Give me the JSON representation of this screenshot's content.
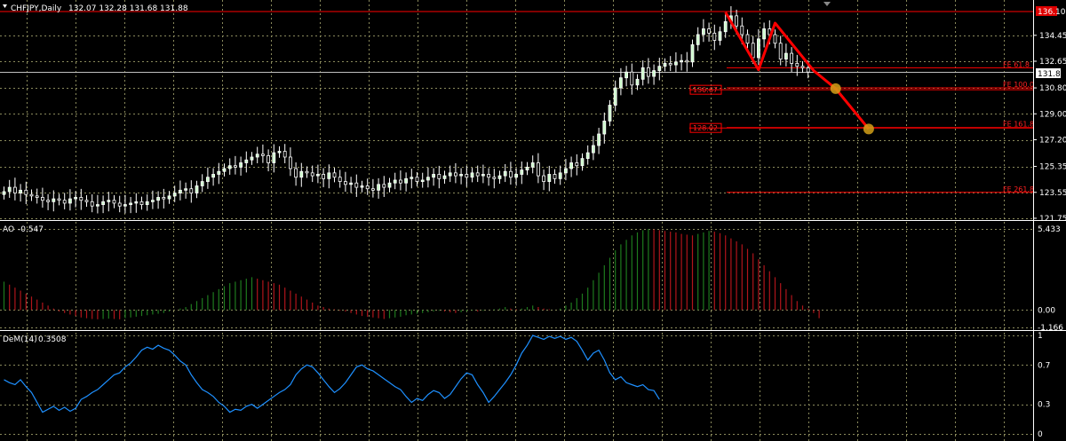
{
  "header": {
    "symbol": "CHFJPY,Daily",
    "ohlc": "132.07 132.28 131.68 131.88"
  },
  "colors": {
    "background": "#000000",
    "grid": "#8a8a5c",
    "bull_candle": "#ccffcc",
    "bear_candle": "#000000",
    "candle_wick": "#ffffff",
    "ao_up": "#1e7a1e",
    "ao_down": "#b0151b",
    "dem_line": "#1e90ff",
    "annotation": "#ff0000",
    "marker": "#d4a017"
  },
  "chart_data": [
    {
      "type": "candlestick",
      "title": "CHFJPY,Daily",
      "ylim": [
        121.75,
        136.1
      ],
      "y_ticks": [
        "134.45",
        "132.65",
        "130.80",
        "129.00",
        "127.20",
        "125.35",
        "123.55",
        "121.75"
      ],
      "current_price": "131.88",
      "top_price": "136.10",
      "grid": true,
      "close": [
        123.6,
        123.9,
        123.5,
        123.7,
        123.4,
        123.3,
        123.2,
        123.0,
        122.9,
        123.1,
        123.0,
        122.8,
        123.1,
        123.2,
        123.0,
        122.9,
        122.6,
        122.7,
        122.9,
        123.0,
        122.8,
        122.6,
        122.7,
        122.8,
        122.9,
        122.7,
        122.9,
        123.0,
        123.2,
        123.1,
        123.3,
        123.5,
        123.7,
        123.8,
        123.5,
        124.0,
        124.3,
        124.6,
        124.8,
        125.0,
        125.2,
        125.4,
        125.3,
        125.6,
        125.8,
        126.0,
        126.2,
        126.1,
        125.6,
        126.3,
        126.4,
        126.0,
        125.2,
        124.6,
        125.0,
        124.9,
        124.7,
        124.8,
        124.5,
        124.9,
        124.6,
        124.3,
        124.1,
        124.2,
        123.9,
        124.0,
        123.8,
        123.7,
        124.1,
        123.9,
        124.2,
        124.4,
        124.2,
        124.5,
        124.6,
        124.3,
        124.4,
        124.6,
        124.8,
        124.5,
        124.7,
        124.9,
        124.7,
        124.8,
        124.6,
        124.9,
        124.7,
        124.8,
        124.6,
        124.5,
        124.7,
        125.0,
        124.6,
        124.8,
        125.1,
        125.3,
        125.6,
        124.7,
        124.3,
        124.8,
        124.5,
        124.9,
        125.2,
        125.6,
        125.4,
        125.9,
        126.3,
        126.8,
        127.6,
        128.5,
        129.6,
        130.8,
        131.5,
        131.9,
        131.0,
        131.4,
        132.2,
        131.6,
        132.0,
        132.3,
        132.5,
        132.4,
        132.6,
        132.7,
        132.6,
        133.8,
        134.5,
        134.9,
        134.6,
        134.1,
        134.7,
        135.4,
        135.8,
        135.1,
        134.5,
        133.9,
        132.9,
        134.2,
        134.9,
        134.5,
        133.9,
        132.8,
        133.2,
        132.5,
        132.3,
        132.2,
        131.9
      ],
      "annotations": {
        "fe_levels": [
          {
            "label": "FE 61.8",
            "price": 132.2
          },
          {
            "label": "FE 100.0",
            "price": 130.8
          },
          {
            "label": "FE 161.8",
            "price": 128.05
          },
          {
            "label": "FE 261.8",
            "price": 123.55
          }
        ],
        "price_tags": [
          {
            "label": "130.67",
            "price": 130.67
          },
          {
            "label": "128.02",
            "price": 128.02
          }
        ],
        "zigzag": [
          {
            "bar": 131,
            "price": 136.05
          },
          {
            "bar": 137,
            "price": 132.05
          },
          {
            "bar": 140,
            "price": 135.3
          },
          {
            "bar": 147,
            "price": 132.0
          },
          {
            "bar": 151,
            "price": 130.75
          },
          {
            "bar": 157,
            "price": 127.95
          }
        ],
        "markers": [
          {
            "bar": 151,
            "price": 130.75
          },
          {
            "bar": 157,
            "price": 127.95
          }
        ]
      }
    },
    {
      "type": "bar",
      "title": "AO",
      "current_value": "-0.547",
      "y_ticks": [
        "5.433",
        "0.00",
        "-1.166"
      ],
      "ylim": [
        -1.166,
        5.433
      ],
      "values": [
        1.9,
        1.7,
        1.5,
        1.3,
        1.1,
        0.9,
        0.7,
        0.5,
        0.3,
        0.1,
        -0.1,
        -0.2,
        -0.3,
        -0.4,
        -0.5,
        -0.55,
        -0.6,
        -0.62,
        -0.6,
        -0.58,
        -0.6,
        -0.62,
        -0.55,
        -0.5,
        -0.45,
        -0.4,
        -0.35,
        -0.3,
        -0.25,
        -0.2,
        -0.1,
        0.0,
        0.1,
        0.2,
        0.4,
        0.6,
        0.8,
        1.0,
        1.2,
        1.4,
        1.6,
        1.8,
        1.9,
        2.0,
        2.1,
        2.2,
        2.1,
        2.0,
        1.9,
        1.8,
        1.7,
        1.5,
        1.3,
        1.1,
        0.9,
        0.7,
        0.5,
        0.3,
        0.2,
        0.1,
        0.05,
        -0.05,
        -0.1,
        -0.2,
        -0.3,
        -0.4,
        -0.45,
        -0.5,
        -0.55,
        -0.6,
        -0.55,
        -0.5,
        -0.45,
        -0.35,
        -0.3,
        -0.25,
        -0.2,
        -0.15,
        -0.1,
        -0.05,
        -0.1,
        -0.15,
        -0.2,
        -0.15,
        -0.1,
        -0.05,
        -0.1,
        -0.05,
        0.0,
        0.05,
        0.1,
        0.2,
        0.1,
        0.05,
        0.1,
        0.2,
        0.3,
        0.2,
        0.1,
        0.05,
        0.0,
        0.1,
        0.3,
        0.5,
        0.8,
        1.1,
        1.5,
        2.0,
        2.5,
        3.0,
        3.5,
        4.0,
        4.4,
        4.7,
        5.0,
        5.2,
        5.35,
        5.433,
        5.4,
        5.35,
        5.3,
        5.25,
        5.2,
        5.1,
        5.05,
        5.0,
        5.1,
        5.2,
        5.3,
        5.25,
        5.15,
        5.0,
        4.8,
        4.6,
        4.4,
        4.1,
        3.8,
        3.4,
        3.0,
        2.6,
        2.2,
        1.8,
        1.4,
        1.0,
        0.6,
        0.3,
        0.1,
        -0.2,
        -0.547
      ],
      "grid": true
    },
    {
      "type": "line",
      "title": "DeM(14)",
      "current_value": "0.3508",
      "y_ticks": [
        "1",
        "0.7",
        "0.3",
        "0"
      ],
      "ylim": [
        0,
        1
      ],
      "values": [
        0.55,
        0.52,
        0.5,
        0.55,
        0.48,
        0.42,
        0.32,
        0.22,
        0.25,
        0.28,
        0.24,
        0.27,
        0.23,
        0.26,
        0.35,
        0.38,
        0.42,
        0.45,
        0.5,
        0.55,
        0.6,
        0.62,
        0.68,
        0.72,
        0.78,
        0.85,
        0.88,
        0.86,
        0.9,
        0.87,
        0.85,
        0.8,
        0.74,
        0.7,
        0.6,
        0.52,
        0.45,
        0.42,
        0.38,
        0.32,
        0.28,
        0.22,
        0.25,
        0.24,
        0.28,
        0.3,
        0.26,
        0.3,
        0.34,
        0.38,
        0.42,
        0.45,
        0.5,
        0.6,
        0.66,
        0.7,
        0.68,
        0.62,
        0.55,
        0.48,
        0.42,
        0.46,
        0.52,
        0.6,
        0.68,
        0.7,
        0.66,
        0.64,
        0.6,
        0.56,
        0.52,
        0.48,
        0.45,
        0.38,
        0.32,
        0.36,
        0.34,
        0.4,
        0.44,
        0.42,
        0.36,
        0.4,
        0.48,
        0.56,
        0.62,
        0.6,
        0.5,
        0.42,
        0.32,
        0.38,
        0.45,
        0.52,
        0.6,
        0.7,
        0.82,
        0.9,
        1.0,
        0.98,
        0.96,
        0.99,
        0.97,
        0.99,
        0.96,
        0.98,
        0.94,
        0.85,
        0.75,
        0.82,
        0.85,
        0.75,
        0.62,
        0.55,
        0.58,
        0.52,
        0.5,
        0.48,
        0.5,
        0.45,
        0.44,
        0.3508
      ],
      "grid": true
    }
  ]
}
